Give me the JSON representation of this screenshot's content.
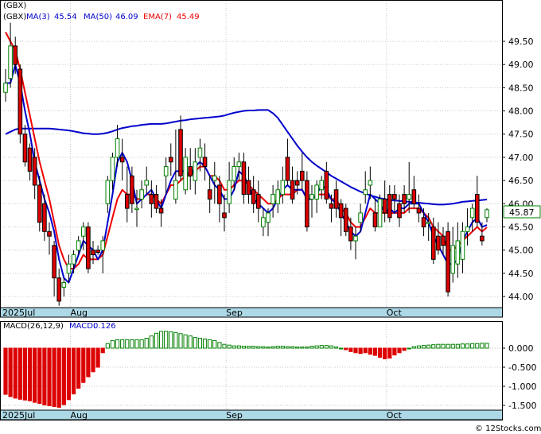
{
  "ticker": "(GBX)",
  "watermark": "© 12Stocks.com",
  "colors": {
    "ma3": "#0000cc",
    "ma50": "#0000cc",
    "ema7": "#ee0000",
    "up_candle": "#008000",
    "down_candle": "#dd0000",
    "price_tag_border": "#008000",
    "axis_band": "#add8e6",
    "macd_neg": "#dd0000",
    "macd_pos": "#008000"
  },
  "legend": {
    "ma3_label": "MA(3)",
    "ma3_value": "45.54",
    "ma50_label": "MA(50)",
    "ma50_value": "46.09",
    "ema7_label": "EMA(7)",
    "ema7_value": "45.49"
  },
  "last_price": "45.87",
  "macd_legend": {
    "label": "MACD(26,12,9)",
    "value_label": "MACD:",
    "value": "0.126"
  },
  "chart_data": [
    {
      "type": "candlestick",
      "price_ylim": [
        43.75,
        50.0
      ],
      "yticks": [
        "49.50",
        "49.00",
        "48.50",
        "48.00",
        "47.50",
        "47.00",
        "46.50",
        "46.00",
        "45.50",
        "45.00",
        "44.50",
        "44.00"
      ],
      "month_labels": [
        {
          "label": "2025Jul",
          "index": 0
        },
        {
          "label": "Aug",
          "index": 14
        },
        {
          "label": "Sep",
          "index": 46
        },
        {
          "label": "Oct",
          "index": 79
        }
      ],
      "candles": [
        [
          48.4,
          48.9,
          48.2,
          48.6
        ],
        [
          48.7,
          49.9,
          48.5,
          49.4
        ],
        [
          49.4,
          49.6,
          48.8,
          49.0
        ],
        [
          48.9,
          49.0,
          47.3,
          47.5
        ],
        [
          47.5,
          47.7,
          46.8,
          46.9
        ],
        [
          47.2,
          47.3,
          46.5,
          46.7
        ],
        [
          47.0,
          47.2,
          46.1,
          46.4
        ],
        [
          46.4,
          46.6,
          45.4,
          45.6
        ],
        [
          46.0,
          46.2,
          45.2,
          45.4
        ],
        [
          45.4,
          45.6,
          44.9,
          45.3
        ],
        [
          45.1,
          45.2,
          44.0,
          44.4
        ],
        [
          44.4,
          44.6,
          43.8,
          43.9
        ],
        [
          44.2,
          44.4,
          44.0,
          44.3
        ],
        [
          44.5,
          44.9,
          44.3,
          44.7
        ],
        [
          44.7,
          45.0,
          44.5,
          44.9
        ],
        [
          45.0,
          45.3,
          44.9,
          45.2
        ],
        [
          45.3,
          45.6,
          45.0,
          45.5
        ],
        [
          45.5,
          45.6,
          44.5,
          44.6
        ],
        [
          45.0,
          45.2,
          44.7,
          44.9
        ],
        [
          45.0,
          45.1,
          44.9,
          44.95
        ],
        [
          45.0,
          45.3,
          44.5,
          45.2
        ],
        [
          46.0,
          46.6,
          45.8,
          46.5
        ],
        [
          46.5,
          47.1,
          46.3,
          47.0
        ],
        [
          47.0,
          47.7,
          46.8,
          47.4
        ],
        [
          47.0,
          47.4,
          46.5,
          46.9
        ],
        [
          46.2,
          46.8,
          45.6,
          45.9
        ],
        [
          46.6,
          46.8,
          45.8,
          46.0
        ],
        [
          45.9,
          46.3,
          45.5,
          45.9
        ],
        [
          46.1,
          46.5,
          45.9,
          46.3
        ],
        [
          46.4,
          46.8,
          46.2,
          46.5
        ],
        [
          46.2,
          46.5,
          45.7,
          46.0
        ],
        [
          46.2,
          46.4,
          45.8,
          45.9
        ],
        [
          45.9,
          46.1,
          45.5,
          45.8
        ],
        [
          46.6,
          47.0,
          46.2,
          46.8
        ],
        [
          47.0,
          47.3,
          46.6,
          46.9
        ],
        [
          46.1,
          47.6,
          46.0,
          46.5
        ],
        [
          47.6,
          47.9,
          46.5,
          46.6
        ],
        [
          46.3,
          47.2,
          46.2,
          47.0
        ],
        [
          46.8,
          47.2,
          46.3,
          46.6
        ],
        [
          46.5,
          47.2,
          46.2,
          46.9
        ],
        [
          47.0,
          47.4,
          46.7,
          47.2
        ],
        [
          47.0,
          47.3,
          46.5,
          46.8
        ],
        [
          46.3,
          46.6,
          45.8,
          46.1
        ],
        [
          46.5,
          46.9,
          46.0,
          46.6
        ],
        [
          46.4,
          46.6,
          45.6,
          46.0
        ],
        [
          45.8,
          46.2,
          45.4,
          45.7
        ],
        [
          46.0,
          46.9,
          45.8,
          46.5
        ],
        [
          46.5,
          47.0,
          46.3,
          46.8
        ],
        [
          46.8,
          47.1,
          46.5,
          46.9
        ],
        [
          46.9,
          47.1,
          46.0,
          46.2
        ],
        [
          46.5,
          46.8,
          46.0,
          46.2
        ],
        [
          46.3,
          46.6,
          45.8,
          46.0
        ],
        [
          46.2,
          46.5,
          45.6,
          45.9
        ],
        [
          45.5,
          45.9,
          45.3,
          45.7
        ],
        [
          45.6,
          45.9,
          45.3,
          45.8
        ],
        [
          46.0,
          46.4,
          45.7,
          46.2
        ],
        [
          46.0,
          46.5,
          45.8,
          46.3
        ],
        [
          46.2,
          46.8,
          46.0,
          46.5
        ],
        [
          47.0,
          47.4,
          46.4,
          46.5
        ],
        [
          46.5,
          46.8,
          46.0,
          46.1
        ],
        [
          46.5,
          46.7,
          46.2,
          46.4
        ],
        [
          46.7,
          47.1,
          46.3,
          46.5
        ],
        [
          46.5,
          46.7,
          45.4,
          45.5
        ],
        [
          46.1,
          46.4,
          45.7,
          46.2
        ],
        [
          46.1,
          46.5,
          45.8,
          46.4
        ],
        [
          46.3,
          46.6,
          46.1,
          46.5
        ],
        [
          46.7,
          46.9,
          46.0,
          46.1
        ],
        [
          46.0,
          46.2,
          45.6,
          45.9
        ],
        [
          46.3,
          46.5,
          45.7,
          45.9
        ],
        [
          46.0,
          46.1,
          45.3,
          45.7
        ],
        [
          45.9,
          46.0,
          45.3,
          45.4
        ],
        [
          45.5,
          45.7,
          45.0,
          45.2
        ],
        [
          45.2,
          45.5,
          44.8,
          45.3
        ],
        [
          45.6,
          46.0,
          45.4,
          45.8
        ],
        [
          46.2,
          46.7,
          46.0,
          46.3
        ],
        [
          46.4,
          46.8,
          46.1,
          46.5
        ],
        [
          45.8,
          46.1,
          45.4,
          45.5
        ],
        [
          45.5,
          46.2,
          45.5,
          46.1
        ],
        [
          46.1,
          46.5,
          45.6,
          45.8
        ],
        [
          46.2,
          46.4,
          45.6,
          45.7
        ],
        [
          46.2,
          46.4,
          45.8,
          46.1
        ],
        [
          46.0,
          46.2,
          45.5,
          45.7
        ],
        [
          46.2,
          46.4,
          45.8,
          46.0
        ],
        [
          46.1,
          46.9,
          45.8,
          46.2
        ],
        [
          46.3,
          46.6,
          45.9,
          46.0
        ],
        [
          45.9,
          46.2,
          45.6,
          45.8
        ],
        [
          45.7,
          45.9,
          45.3,
          45.5
        ],
        [
          45.6,
          45.8,
          45.2,
          45.6
        ],
        [
          45.5,
          45.7,
          44.7,
          44.8
        ],
        [
          45.3,
          45.6,
          44.9,
          45.0
        ],
        [
          45.3,
          45.5,
          44.9,
          45.1
        ],
        [
          45.4,
          45.6,
          44.0,
          44.1
        ],
        [
          44.5,
          45.5,
          44.3,
          45.1
        ],
        [
          44.7,
          45.6,
          44.4,
          45.2
        ],
        [
          44.8,
          45.6,
          44.5,
          45.4
        ],
        [
          45.4,
          45.9,
          45.1,
          45.5
        ],
        [
          45.7,
          46.0,
          45.4,
          45.9
        ],
        [
          46.2,
          46.6,
          45.5,
          45.6
        ],
        [
          45.3,
          45.6,
          45.1,
          45.2
        ],
        [
          45.7,
          45.9,
          45.6,
          45.87
        ]
      ],
      "ma3": [
        48.6,
        48.6,
        49.0,
        48.6,
        48.0,
        47.5,
        46.9,
        46.5,
        46.1,
        45.8,
        45.4,
        44.8,
        44.4,
        44.3,
        44.6,
        44.9,
        45.2,
        45.1,
        45.0,
        44.8,
        45.0,
        45.6,
        46.2,
        46.9,
        47.1,
        46.9,
        46.5,
        46.0,
        46.1,
        46.2,
        46.3,
        46.1,
        45.9,
        46.2,
        46.5,
        46.7,
        46.7,
        46.7,
        46.6,
        46.8,
        46.9,
        46.8,
        46.6,
        46.4,
        46.3,
        46.1,
        46.1,
        46.3,
        46.7,
        46.6,
        46.4,
        46.1,
        46.0,
        45.9,
        45.8,
        45.9,
        46.1,
        46.3,
        46.4,
        46.3,
        46.3,
        46.3,
        46.1,
        46.1,
        46.2,
        46.4,
        46.3,
        46.1,
        46.0,
        45.8,
        45.6,
        45.4,
        45.3,
        45.4,
        45.8,
        46.2,
        46.1,
        46.0,
        45.8,
        45.9,
        45.8,
        45.9,
        45.9,
        46.0,
        46.0,
        46.0,
        45.8,
        45.6,
        45.3,
        45.1,
        44.9,
        44.7,
        44.7,
        44.8,
        45.2,
        45.4,
        45.6,
        45.7,
        45.5,
        45.54
      ],
      "ema7": [
        49.7,
        49.5,
        49.3,
        48.9,
        48.4,
        47.9,
        47.4,
        46.9,
        46.5,
        46.1,
        45.6,
        45.1,
        44.8,
        44.6,
        44.6,
        44.7,
        44.9,
        44.8,
        44.8,
        44.8,
        44.9,
        45.3,
        45.7,
        46.1,
        46.3,
        46.2,
        46.2,
        46.1,
        46.1,
        46.2,
        46.2,
        46.1,
        46.0,
        46.2,
        46.4,
        46.4,
        46.5,
        46.6,
        46.6,
        46.7,
        46.8,
        46.8,
        46.6,
        46.6,
        46.5,
        46.3,
        46.3,
        46.4,
        46.5,
        46.5,
        46.4,
        46.3,
        46.2,
        46.1,
        46.0,
        46.0,
        46.1,
        46.2,
        46.2,
        46.2,
        46.3,
        46.3,
        46.1,
        46.1,
        46.2,
        46.2,
        46.2,
        46.1,
        46.1,
        45.9,
        45.8,
        45.6,
        45.5,
        45.5,
        45.7,
        45.9,
        45.8,
        45.8,
        45.8,
        45.8,
        45.8,
        45.8,
        45.8,
        45.9,
        45.9,
        45.9,
        45.8,
        45.7,
        45.5,
        45.4,
        45.3,
        45.0,
        45.0,
        45.1,
        45.2,
        45.3,
        45.4,
        45.5,
        45.4,
        45.49
      ],
      "ma50": [
        47.5,
        47.55,
        47.6,
        47.62,
        47.62,
        47.62,
        47.62,
        47.62,
        47.62,
        47.62,
        47.61,
        47.6,
        47.59,
        47.58,
        47.56,
        47.54,
        47.52,
        47.51,
        47.5,
        47.5,
        47.51,
        47.53,
        47.56,
        47.6,
        47.63,
        47.65,
        47.67,
        47.68,
        47.7,
        47.71,
        47.72,
        47.72,
        47.72,
        47.73,
        47.75,
        47.77,
        47.79,
        47.8,
        47.82,
        47.83,
        47.84,
        47.85,
        47.86,
        47.87,
        47.88,
        47.9,
        47.93,
        47.96,
        47.98,
        48.0,
        48.01,
        48.01,
        48.02,
        48.02,
        48.02,
        47.95,
        47.85,
        47.7,
        47.55,
        47.4,
        47.25,
        47.12,
        47.0,
        46.9,
        46.82,
        46.75,
        46.68,
        46.6,
        46.54,
        46.48,
        46.42,
        46.36,
        46.31,
        46.26,
        46.22,
        46.18,
        46.15,
        46.12,
        46.1,
        46.08,
        46.07,
        46.06,
        46.05,
        46.04,
        46.03,
        46.02,
        46.01,
        46.0,
        45.99,
        45.98,
        45.98,
        45.99,
        46.0,
        46.02,
        46.04,
        46.05,
        46.06,
        46.07,
        46.08,
        46.09
      ]
    },
    {
      "type": "bar",
      "title": "MACD(26,12,9)",
      "ylim": [
        -1.55,
        0.3
      ],
      "yticks": [
        "0.000",
        "-0.500",
        "-1.000",
        "-1.500"
      ],
      "month_labels": [
        {
          "label": "2025Jul",
          "index": 0
        },
        {
          "label": "Aug",
          "index": 14
        },
        {
          "label": "Sep",
          "index": 46
        },
        {
          "label": "Oct",
          "index": 79
        }
      ],
      "values": [
        -1.21,
        -1.27,
        -1.31,
        -1.34,
        -1.36,
        -1.38,
        -1.42,
        -1.45,
        -1.49,
        -1.51,
        -1.53,
        -1.55,
        -1.48,
        -1.35,
        -1.2,
        -1.05,
        -0.9,
        -0.75,
        -0.62,
        -0.5,
        -0.12,
        0.12,
        0.2,
        0.22,
        0.22,
        0.22,
        0.22,
        0.22,
        0.22,
        0.26,
        0.32,
        0.39,
        0.44,
        0.44,
        0.43,
        0.41,
        0.38,
        0.35,
        0.32,
        0.28,
        0.26,
        0.24,
        0.22,
        0.2,
        0.15,
        0.1,
        0.08,
        0.06,
        0.06,
        0.05,
        0.05,
        0.05,
        0.04,
        0.04,
        0.03,
        0.04,
        0.05,
        0.05,
        0.04,
        0.04,
        0.03,
        0.03,
        0.03,
        0.05,
        0.06,
        0.07,
        0.07,
        0.06,
        0.03,
        0.0,
        -0.04,
        -0.09,
        -0.12,
        -0.14,
        -0.12,
        -0.16,
        -0.19,
        -0.24,
        -0.28,
        -0.26,
        -0.18,
        -0.12,
        -0.06,
        0.0,
        0.04,
        0.06,
        0.07,
        0.08,
        0.09,
        0.1,
        0.1,
        0.1,
        0.1,
        0.1,
        0.11,
        0.11,
        0.12,
        0.12,
        0.13,
        0.126
      ]
    }
  ]
}
